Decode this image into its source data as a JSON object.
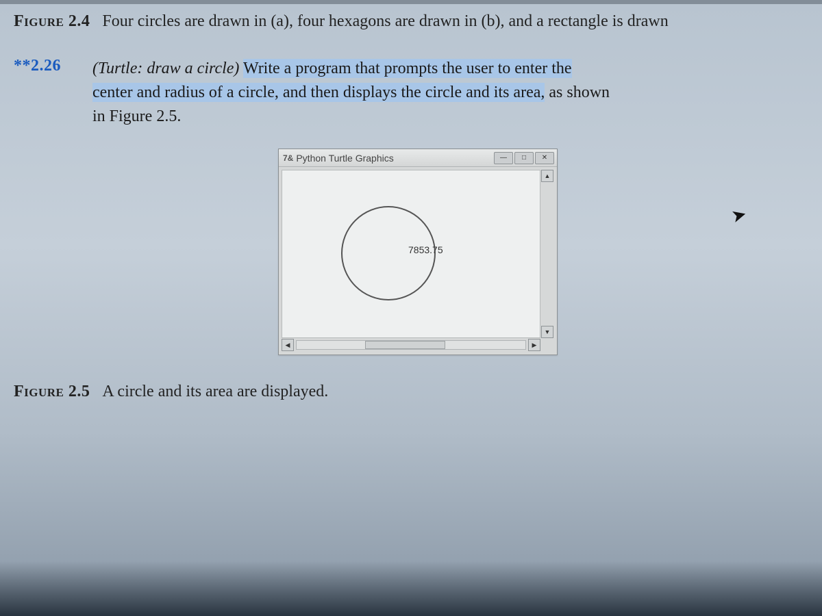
{
  "figure24": {
    "label": "Figure 2.4",
    "caption": "Four circles are drawn in (a), four hexagons are drawn in (b), and a rectangle is drawn"
  },
  "exercise": {
    "number": "**2.26",
    "title": "(Turtle: draw a circle)",
    "body_hl1": "Write a program that prompts the user to enter the",
    "body_hl2": "center and radius of a circle, and then displays the circle and its area,",
    "body_plain1": " as shown",
    "body_plain2": "in Figure 2.5."
  },
  "window": {
    "title": "Python Turtle Graphics",
    "tk_prefix": "7&",
    "min": "—",
    "max": "□",
    "close": "✕",
    "area_text": "7853.75",
    "up": "▲",
    "down": "▼",
    "left": "◀",
    "right": "▶"
  },
  "figure25": {
    "label": "Figure 2.5",
    "caption": "A circle and its area are displayed."
  }
}
